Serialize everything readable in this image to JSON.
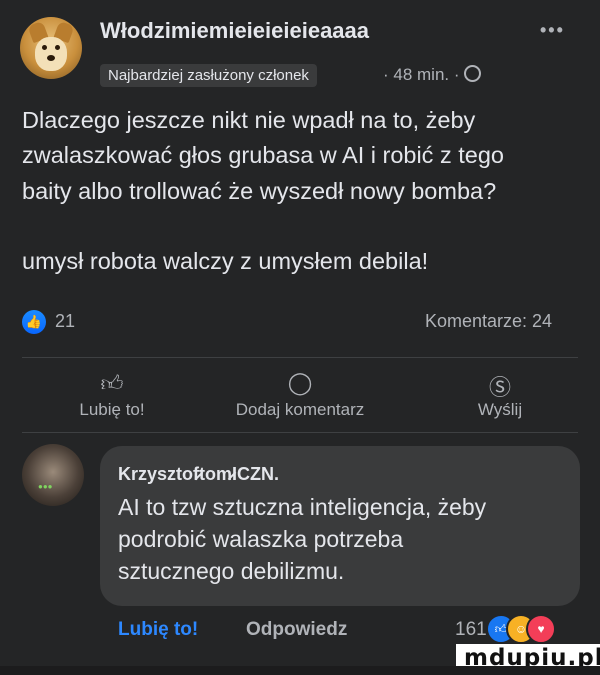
{
  "post": {
    "author": "Włodzimiemieieieieieaaaa",
    "more_icon": "more-dots-icon",
    "badge": "Najbardziej zasłużony członek",
    "time": "· 48 min. ·",
    "privacy_icon": "globe-icon",
    "text": "Dlaczego jeszcze nikt nie wpadł na to, żeby\nzwalaszkować głos grubasa w AI i robić z tego\nbaity albo trollować że wyszedł nowy bomba?\n\numysł robota walczy z umysłem debila!",
    "reactions_count": "21",
    "comments_count": "Komentarze: 24"
  },
  "actions": [
    {
      "icon": "thumbs-up-icon",
      "label": "Lubię to!"
    },
    {
      "icon": "comment-icon",
      "label": "Dodaj komentarz"
    },
    {
      "icon": "messenger-icon",
      "label": "Wyślij"
    }
  ],
  "comment": {
    "author": "Krzysztof̷tom̷ICZN.",
    "text": "AI to tzw sztuczna inteligencja, żeby\npodrobić walaszka potrzeba\nsztucznego debilizmu.",
    "like_label": "Lubię to!",
    "reply_label": "Odpowiedz",
    "reactions_count": "161",
    "reaction_icons": [
      "like-reaction-icon",
      "haha-reaction-icon",
      "love-reaction-icon"
    ]
  },
  "watermark": "mdupiu.pl",
  "colors": {
    "background": "#242526",
    "bubble": "#3a3b3c",
    "link_blue": "#2d88ff"
  }
}
